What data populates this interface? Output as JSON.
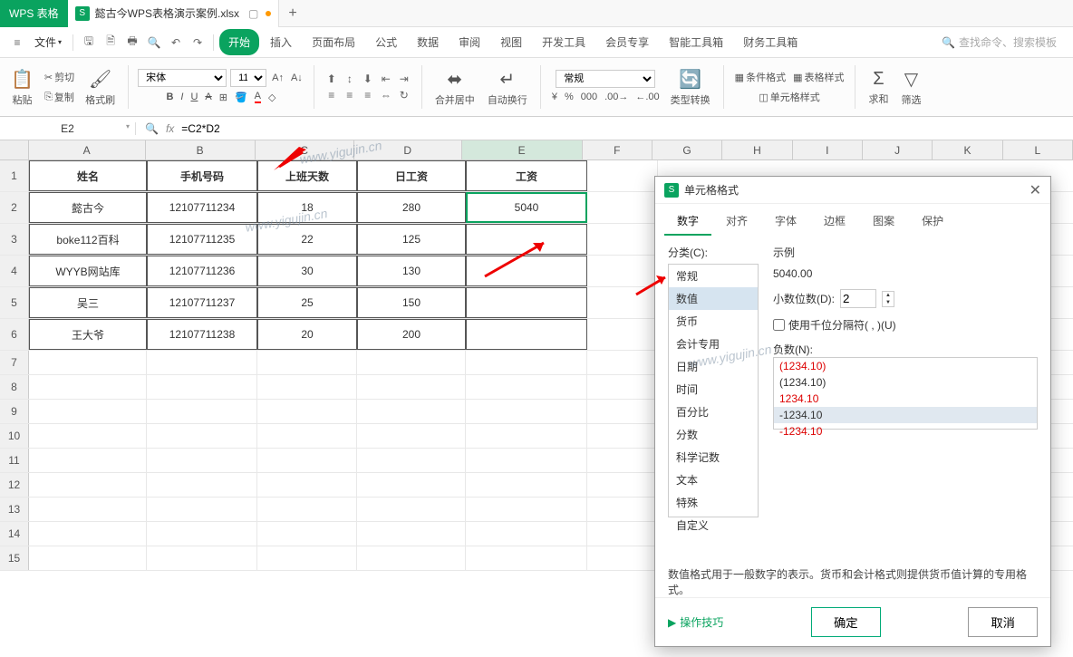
{
  "app": {
    "name": "WPS 表格",
    "file_tab": "懿古今WPS表格演示案例.xlsx",
    "tab_add": "+"
  },
  "menubar": {
    "file": "文件",
    "tabs": [
      "开始",
      "插入",
      "页面布局",
      "公式",
      "数据",
      "审阅",
      "视图",
      "开发工具",
      "会员专享",
      "智能工具箱",
      "财务工具箱"
    ],
    "search_placeholder": "查找命令、搜索模板"
  },
  "ribbon": {
    "paste": "粘贴",
    "cut": "剪切",
    "copy": "复制",
    "format_painter": "格式刷",
    "font_name": "宋体",
    "font_size": "11",
    "merge_center": "合并居中",
    "wrap": "自动换行",
    "num_format": "常规",
    "type_convert": "类型转换",
    "cond_fmt": "条件格式",
    "table_style": "表格样式",
    "cell_style": "单元格样式",
    "sum": "求和",
    "filter": "筛选"
  },
  "formula_bar": {
    "cell_ref": "E2",
    "formula": "=C2*D2"
  },
  "columns": [
    "A",
    "B",
    "C",
    "D",
    "E",
    "F",
    "G",
    "H",
    "I",
    "J",
    "K",
    "L"
  ],
  "table": {
    "headers": [
      "姓名",
      "手机号码",
      "上班天数",
      "日工资",
      "工资"
    ],
    "rows": [
      {
        "name": "懿古今",
        "phone": "12107711234",
        "days": "18",
        "daily": "280",
        "salary": "5040"
      },
      {
        "name": "boke112百科",
        "phone": "12107711235",
        "days": "22",
        "daily": "125",
        "salary": ""
      },
      {
        "name": "WYYB网站库",
        "phone": "12107711236",
        "days": "30",
        "daily": "130",
        "salary": ""
      },
      {
        "name": "吴三",
        "phone": "12107711237",
        "days": "25",
        "daily": "150",
        "salary": ""
      },
      {
        "name": "王大爷",
        "phone": "12107711238",
        "days": "20",
        "daily": "200",
        "salary": ""
      }
    ]
  },
  "dialog": {
    "title": "单元格格式",
    "tabs": [
      "数字",
      "对齐",
      "字体",
      "边框",
      "图案",
      "保护"
    ],
    "category_label": "分类(C):",
    "categories": [
      "常规",
      "数值",
      "货币",
      "会计专用",
      "日期",
      "时间",
      "百分比",
      "分数",
      "科学记数",
      "文本",
      "特殊",
      "自定义"
    ],
    "sample_label": "示例",
    "sample_value": "5040.00",
    "decimal_label": "小数位数(D):",
    "decimal_value": "2",
    "thousand_sep": "使用千位分隔符( , )(U)",
    "neg_label": "负数(N):",
    "neg_list": [
      "(1234.10)",
      "(1234.10)",
      "1234.10",
      "-1234.10",
      "-1234.10"
    ],
    "note": "数值格式用于一般数字的表示。货币和会计格式则提供货币值计算的专用格式。",
    "tips": "操作技巧",
    "ok": "确定",
    "cancel": "取消"
  },
  "watermark": "www.yigujin.cn"
}
